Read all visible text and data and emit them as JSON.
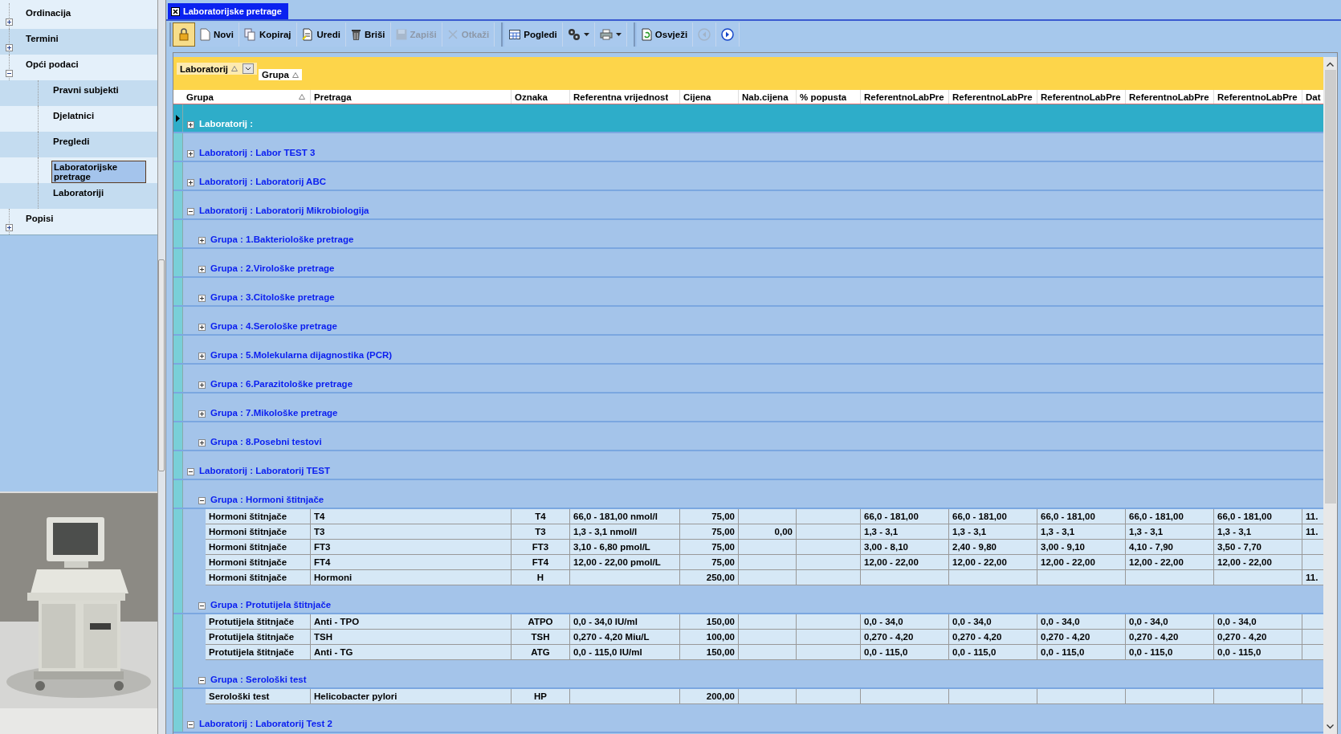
{
  "sidebar": {
    "items": [
      {
        "label": "Ordinacija",
        "expanded": false,
        "selected": false
      },
      {
        "label": "Termini",
        "expanded": false,
        "selected": false
      },
      {
        "label": "Opći podaci",
        "expanded": true,
        "selected": false,
        "children": [
          {
            "label": "Pravni subjekti",
            "selected": false
          },
          {
            "label": "Djelatnici",
            "selected": false
          },
          {
            "label": "Pregledi",
            "selected": false
          },
          {
            "label": "Laboratorijske pretrage",
            "selected": true
          },
          {
            "label": "Laboratoriji",
            "selected": false
          }
        ]
      },
      {
        "label": "Popisi",
        "expanded": false,
        "selected": false
      }
    ]
  },
  "tabs": [
    {
      "label": "Laboratorijske pretrage",
      "selected": true
    }
  ],
  "toolbar": {
    "groups": [
      [
        {
          "kind": "lock",
          "pressed": true,
          "disabled": false
        },
        {
          "kind": "new",
          "label": "Novi",
          "pressed": false,
          "disabled": false
        },
        {
          "kind": "copy",
          "label": "Kopiraj",
          "pressed": false,
          "disabled": false
        },
        {
          "kind": "edit",
          "label": "Uredi",
          "pressed": false,
          "disabled": false
        },
        {
          "kind": "delete",
          "label": "Briši",
          "pressed": false,
          "disabled": false
        },
        {
          "kind": "save",
          "label": "Zapiši",
          "pressed": false,
          "disabled": true
        },
        {
          "kind": "cancel",
          "label": "Otkaži",
          "pressed": false,
          "disabled": true
        }
      ],
      [
        {
          "kind": "views",
          "label": "Pogledi",
          "pressed": false,
          "disabled": false
        },
        {
          "kind": "tools",
          "dropdown": true,
          "pressed": false,
          "disabled": false
        },
        {
          "kind": "print",
          "dropdown": true,
          "pressed": false,
          "disabled": false
        }
      ],
      [
        {
          "kind": "refresh",
          "label": "Osvježi",
          "pressed": false,
          "disabled": false
        },
        {
          "kind": "back",
          "pressed": false,
          "disabled": true
        },
        {
          "kind": "forward",
          "pressed": false,
          "disabled": false
        }
      ]
    ]
  },
  "grid": {
    "group_panel": [
      {
        "label": "Laboratorij",
        "sorted": true,
        "dropdown": true
      },
      {
        "label": "Grupa",
        "sorted": true,
        "dropdown": false
      }
    ],
    "columns": [
      {
        "label": "Grupa",
        "sorted": true
      },
      {
        "label": "Pretraga",
        "sorted": false
      },
      {
        "label": "Oznaka",
        "sorted": false
      },
      {
        "label": "Referentna vrijednost",
        "sorted": false
      },
      {
        "label": "Cijena",
        "sorted": false
      },
      {
        "label": "Nab.cijena",
        "sorted": false
      },
      {
        "label": "% popusta",
        "sorted": false
      },
      {
        "label": "ReferentnoLabPre",
        "sorted": false
      },
      {
        "label": "ReferentnoLabPre",
        "sorted": false
      },
      {
        "label": "ReferentnoLabPre",
        "sorted": false
      },
      {
        "label": "ReferentnoLabPre",
        "sorted": false
      },
      {
        "label": "ReferentnoLabPre",
        "sorted": false
      },
      {
        "label": "Dat",
        "sorted": false
      }
    ],
    "rows": [
      {
        "kind": "group",
        "label": "Laboratorij :",
        "expanded": false,
        "selected": true
      },
      {
        "kind": "group",
        "label": "Laboratorij : Labor TEST 3",
        "expanded": false,
        "selected": false
      },
      {
        "kind": "group",
        "label": "Laboratorij : Laboratorij ABC",
        "expanded": false,
        "selected": false
      },
      {
        "kind": "group",
        "label": "Laboratorij : Laboratorij Mikrobiologija",
        "expanded": true,
        "selected": false,
        "children": [
          {
            "kind": "group",
            "label": "Grupa : 1.Bakteriološke pretrage",
            "expanded": false,
            "selected": false
          },
          {
            "kind": "group",
            "label": "Grupa : 2.Virološke pretrage",
            "expanded": false,
            "selected": false
          },
          {
            "kind": "group",
            "label": "Grupa : 3.Citološke pretrage",
            "expanded": false,
            "selected": false
          },
          {
            "kind": "group",
            "label": "Grupa : 4.Serološke pretrage",
            "expanded": false,
            "selected": false
          },
          {
            "kind": "group",
            "label": "Grupa : 5.Molekularna dijagnostika (PCR)",
            "expanded": false,
            "selected": false
          },
          {
            "kind": "group",
            "label": "Grupa : 6.Parazitološke pretrage",
            "expanded": false,
            "selected": false
          },
          {
            "kind": "group",
            "label": "Grupa : 7.Mikološke pretrage",
            "expanded": false,
            "selected": false
          },
          {
            "kind": "group",
            "label": "Grupa : 8.Posebni testovi",
            "expanded": false,
            "selected": false
          }
        ]
      },
      {
        "kind": "group",
        "label": "Laboratorij : Laboratorij TEST",
        "expanded": true,
        "selected": false,
        "children": [
          {
            "kind": "group",
            "label": "Grupa : Hormoni štitnjače",
            "expanded": true,
            "selected": false,
            "children": [
              {
                "kind": "data",
                "selected": false,
                "cells": [
                  "Hormoni štitnjače",
                  "T4",
                  "T4",
                  "66,0 - 181,00 nmol/l",
                  "75,00",
                  null,
                  null,
                  "66,0 - 181,00",
                  "66,0 - 181,00",
                  "66,0 - 181,00",
                  "66,0 - 181,00",
                  "66,0 - 181,00",
                  "11."
                ]
              },
              {
                "kind": "data",
                "selected": false,
                "cells": [
                  "Hormoni štitnjače",
                  "T3",
                  "T3",
                  "1,3 - 3,1 nmol/l",
                  "75,00",
                  "0,00",
                  null,
                  "1,3 - 3,1",
                  "1,3 - 3,1",
                  "1,3 - 3,1",
                  "1,3 - 3,1",
                  "1,3 - 3,1",
                  "11."
                ]
              },
              {
                "kind": "data",
                "selected": false,
                "cells": [
                  "Hormoni štitnjače",
                  "FT3",
                  "FT3",
                  "3,10 - 6,80 pmol/L",
                  "75,00",
                  null,
                  null,
                  "3,00 - 8,10",
                  "2,40 - 9,80",
                  "3,00 - 9,10",
                  "4,10 - 7,90",
                  "3,50 - 7,70",
                  null
                ]
              },
              {
                "kind": "data",
                "selected": false,
                "cells": [
                  "Hormoni štitnjače",
                  "FT4",
                  "FT4",
                  "12,00 - 22,00 pmol/L",
                  "75,00",
                  null,
                  null,
                  "12,00 - 22,00",
                  "12,00 - 22,00",
                  "12,00 - 22,00",
                  "12,00 - 22,00",
                  "12,00 - 22,00",
                  null
                ]
              },
              {
                "kind": "data",
                "selected": false,
                "cells": [
                  "Hormoni štitnjače",
                  "Hormoni",
                  "H",
                  null,
                  "250,00",
                  null,
                  null,
                  null,
                  null,
                  null,
                  null,
                  null,
                  "11."
                ]
              }
            ]
          },
          {
            "kind": "group",
            "label": "Grupa : Protutijela štitnjače",
            "expanded": true,
            "selected": false,
            "children": [
              {
                "kind": "data",
                "selected": false,
                "cells": [
                  "Protutijela štitnjače",
                  "Anti - TPO",
                  "ATPO",
                  "0,0 - 34,0 IU/ml",
                  "150,00",
                  null,
                  null,
                  "0,0 - 34,0",
                  "0,0 - 34,0",
                  "0,0 - 34,0",
                  "0,0 - 34,0",
                  "0,0 - 34,0",
                  null
                ]
              },
              {
                "kind": "data",
                "selected": false,
                "cells": [
                  "Protutijela štitnjače",
                  "TSH",
                  "TSH",
                  "0,270 - 4,20  Miu/L",
                  "100,00",
                  null,
                  null,
                  "0,270 - 4,20",
                  "0,270 - 4,20",
                  "0,270 - 4,20",
                  "0,270 - 4,20",
                  "0,270 - 4,20",
                  null
                ]
              },
              {
                "kind": "data",
                "selected": false,
                "cells": [
                  "Protutijela štitnjače",
                  "Anti - TG",
                  "ATG",
                  "0,0 - 115,0  IU/ml",
                  "150,00",
                  null,
                  null,
                  "0,0 - 115,0",
                  "0,0 - 115,0",
                  "0,0 - 115,0",
                  "0,0 - 115,0",
                  "0,0 - 115,0",
                  null
                ]
              }
            ]
          },
          {
            "kind": "group",
            "label": "Grupa : Serološki test",
            "expanded": true,
            "selected": false,
            "children": [
              {
                "kind": "data",
                "selected": false,
                "cells": [
                  "Serološki test",
                  "Helicobacter pylori",
                  "HP",
                  null,
                  "200,00",
                  null,
                  null,
                  null,
                  null,
                  null,
                  null,
                  null,
                  null
                ]
              }
            ]
          }
        ]
      },
      {
        "kind": "group",
        "label": "Laboratorij : Laboratorij Test 2",
        "expanded": true,
        "selected": false
      }
    ]
  }
}
